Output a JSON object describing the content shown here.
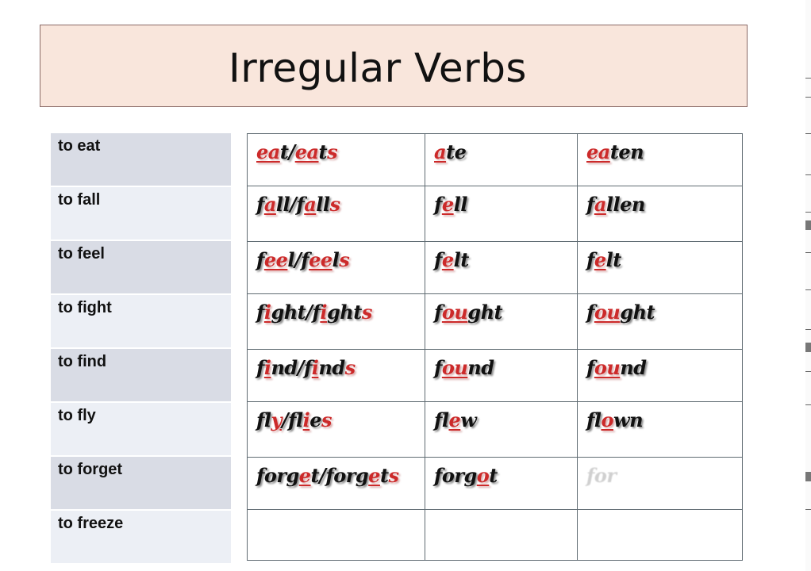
{
  "title": "Irregular Verbs",
  "colors": {
    "title_bg": "#f9e6dc",
    "highlight": "#cc2a2a",
    "row_dark": "#d9dce5",
    "row_light": "#eceff5"
  },
  "infinitives": [
    "to eat",
    "to fall",
    "to feel",
    "to fight",
    "to find",
    "to fly",
    "to forget",
    "to freeze"
  ],
  "rows": [
    {
      "present": [
        {
          "t": "ea",
          "s": "hl"
        },
        {
          "t": "t/"
        },
        {
          "t": "ea",
          "s": "hl"
        },
        {
          "t": "t"
        },
        {
          "t": "s",
          "s": "end"
        }
      ],
      "past": [
        {
          "t": "a",
          "s": "hl"
        },
        {
          "t": "te"
        }
      ],
      "participle": [
        {
          "t": "ea",
          "s": "hl"
        },
        {
          "t": "ten"
        }
      ]
    },
    {
      "present": [
        {
          "t": "f"
        },
        {
          "t": "a",
          "s": "hl"
        },
        {
          "t": "ll/f"
        },
        {
          "t": "a",
          "s": "hl"
        },
        {
          "t": "ll"
        },
        {
          "t": "s",
          "s": "end"
        }
      ],
      "past": [
        {
          "t": "f"
        },
        {
          "t": "e",
          "s": "hl"
        },
        {
          "t": "ll"
        }
      ],
      "participle": [
        {
          "t": "f"
        },
        {
          "t": "a",
          "s": "hl"
        },
        {
          "t": "llen"
        }
      ]
    },
    {
      "present": [
        {
          "t": "f"
        },
        {
          "t": "ee",
          "s": "hl"
        },
        {
          "t": "l/f"
        },
        {
          "t": "ee",
          "s": "hl"
        },
        {
          "t": "l"
        },
        {
          "t": "s",
          "s": "end"
        }
      ],
      "past": [
        {
          "t": "f"
        },
        {
          "t": "e",
          "s": "hl"
        },
        {
          "t": "lt"
        }
      ],
      "participle": [
        {
          "t": "f"
        },
        {
          "t": "e",
          "s": "hl"
        },
        {
          "t": "lt"
        }
      ]
    },
    {
      "present": [
        {
          "t": "f"
        },
        {
          "t": "i",
          "s": "hl"
        },
        {
          "t": "ght/f"
        },
        {
          "t": "i",
          "s": "hl"
        },
        {
          "t": "ght"
        },
        {
          "t": "s",
          "s": "end"
        }
      ],
      "past": [
        {
          "t": "f"
        },
        {
          "t": "ou",
          "s": "hl"
        },
        {
          "t": "ght"
        }
      ],
      "participle": [
        {
          "t": "f"
        },
        {
          "t": "ou",
          "s": "hl"
        },
        {
          "t": "ght"
        }
      ]
    },
    {
      "present": [
        {
          "t": "f"
        },
        {
          "t": "i",
          "s": "hl"
        },
        {
          "t": "nd/f"
        },
        {
          "t": "i",
          "s": "hl"
        },
        {
          "t": "nd"
        },
        {
          "t": "s",
          "s": "end"
        }
      ],
      "past": [
        {
          "t": "f"
        },
        {
          "t": "ou",
          "s": "hl"
        },
        {
          "t": "nd"
        }
      ],
      "participle": [
        {
          "t": "f"
        },
        {
          "t": "ou",
          "s": "hl"
        },
        {
          "t": "nd"
        }
      ]
    },
    {
      "present": [
        {
          "t": "fl"
        },
        {
          "t": "y",
          "s": "hl"
        },
        {
          "t": "/fl"
        },
        {
          "t": "i",
          "s": "hl"
        },
        {
          "t": "e"
        },
        {
          "t": "s",
          "s": "end"
        }
      ],
      "past": [
        {
          "t": "fl"
        },
        {
          "t": "e",
          "s": "hl"
        },
        {
          "t": "w"
        }
      ],
      "participle": [
        {
          "t": "fl"
        },
        {
          "t": "o",
          "s": "hl"
        },
        {
          "t": "wn"
        }
      ]
    },
    {
      "present": [
        {
          "t": "forg"
        },
        {
          "t": "e",
          "s": "hl"
        },
        {
          "t": "t/forg"
        },
        {
          "t": "e",
          "s": "hl"
        },
        {
          "t": "t"
        },
        {
          "t": "s",
          "s": "end"
        }
      ],
      "past": [
        {
          "t": "forg"
        },
        {
          "t": "o",
          "s": "hl"
        },
        {
          "t": "t"
        }
      ],
      "participle": [
        {
          "t": "for",
          "s": "faded"
        }
      ]
    },
    {
      "present": [],
      "past": [],
      "participle": []
    }
  ]
}
